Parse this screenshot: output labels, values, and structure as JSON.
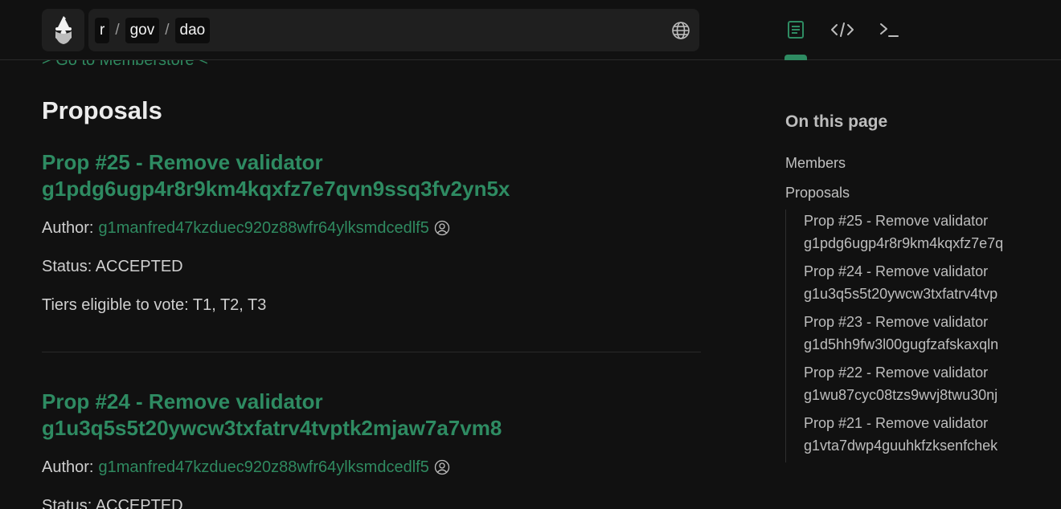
{
  "header": {
    "breadcrumb": [
      "r",
      "gov",
      "dao"
    ],
    "breadcrumb_separator": "/",
    "modes": [
      "document-icon",
      "code-icon",
      "terminal-icon"
    ]
  },
  "main": {
    "back_link": "> Go to Memberstore <",
    "section_title": "Proposals",
    "proposals": [
      {
        "title": "Prop #25 - Remove validator",
        "address": "g1pdg6ugp4r8r9km4kqxfz7e7qvn9ssq3fv2yn5x",
        "author_label": "Author:",
        "author": "g1manfred47kzduec920z88wfr64ylksmdcedlf5",
        "status": "Status: ACCEPTED",
        "tiers": "Tiers eligible to vote: T1, T2, T3"
      },
      {
        "title": "Prop #24 - Remove validator",
        "address": "g1u3q5s5t20ywcw3txfatrv4tvptk2mjaw7a7vm8",
        "author_label": "Author:",
        "author": "g1manfred47kzduec920z88wfr64ylksmdcedlf5",
        "status": "Status: ACCEPTED"
      }
    ]
  },
  "toc": {
    "title": "On this page",
    "links": [
      "Members",
      "Proposals"
    ],
    "sub_items": [
      {
        "line1": "Prop #25 - Remove validator",
        "line2": "g1pdg6ugp4r8r9km4kqxfz7e7q"
      },
      {
        "line1": "Prop #24 - Remove validator",
        "line2": "g1u3q5s5t20ywcw3txfatrv4tvp"
      },
      {
        "line1": "Prop #23 - Remove validator",
        "line2": "g1d5hh9fw3l00gugfzafskaxqln"
      },
      {
        "line1": "Prop #22 - Remove validator",
        "line2": "g1wu87cyc08tzs9wvj8twu30nj"
      },
      {
        "line1": "Prop #21 - Remove validator",
        "line2": "g1vta7dwp4guuhkfzksenfchek"
      }
    ]
  },
  "colors": {
    "background": "#111111",
    "accent_green": "#2e8b62",
    "panel": "#1f1f1f"
  }
}
